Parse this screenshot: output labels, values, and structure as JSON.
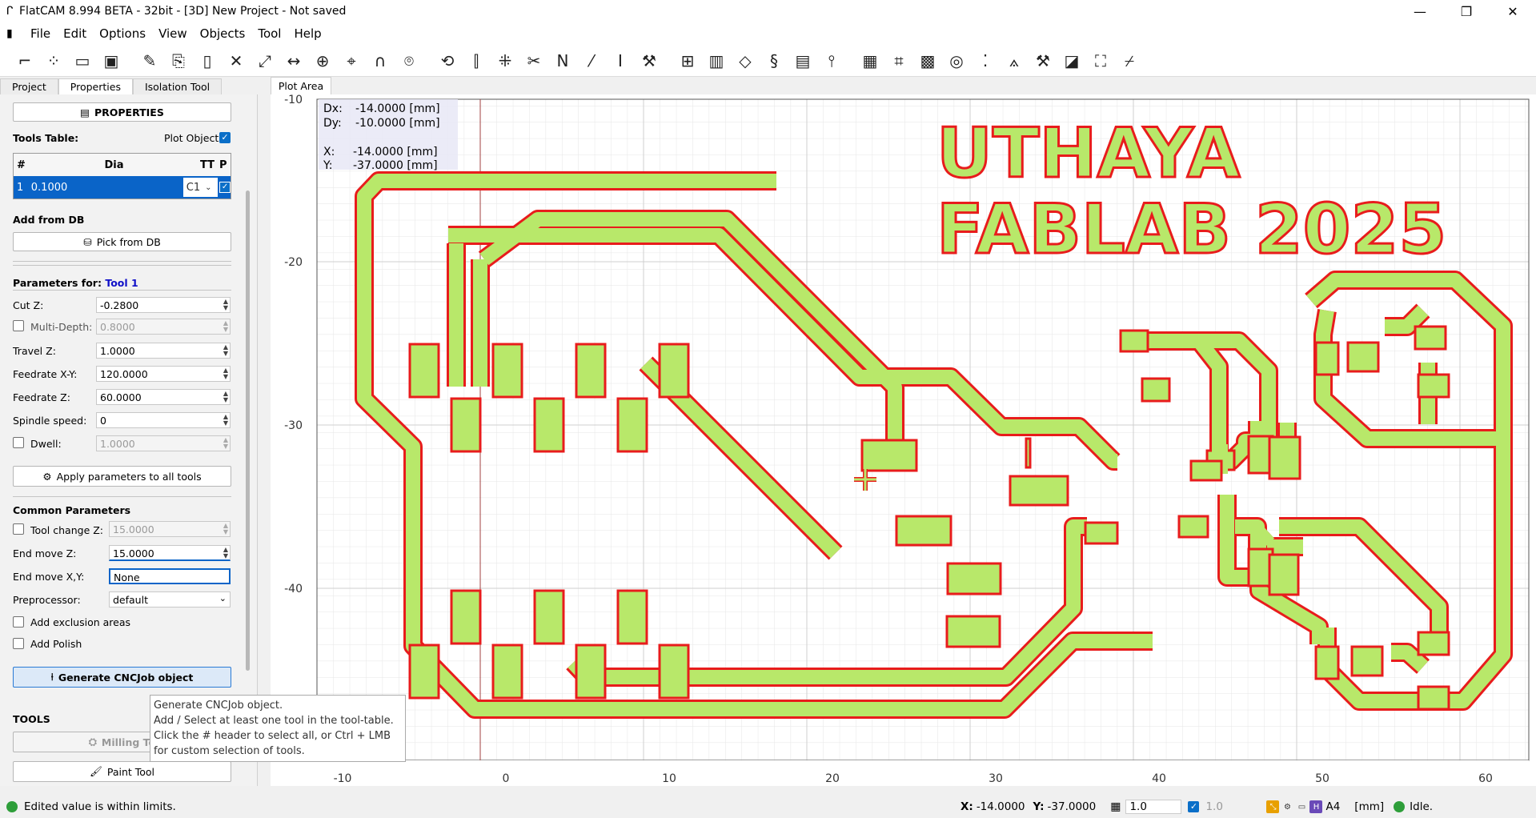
{
  "window": {
    "title": "FlatCAM 8.994 BETA - 32bit - [3D]    New Project - Not saved",
    "minimize": "—",
    "maximize": "❐",
    "close": "✕"
  },
  "menu": [
    "File",
    "Edit",
    "Options",
    "View",
    "Objects",
    "Tool",
    "Help"
  ],
  "tabs": {
    "project": "Project",
    "properties": "Properties",
    "isolation": "Isolation Tool"
  },
  "panel": {
    "properties_btn": "PROPERTIES",
    "tools_table_label": "Tools Table:",
    "plot_object_label": "Plot Object",
    "table": {
      "headers": [
        "#",
        "Dia",
        "TT",
        "P"
      ],
      "rows": [
        {
          "num": "1",
          "dia": "0.1000",
          "tt": "C1"
        }
      ]
    },
    "add_from_db": "Add from DB",
    "pick_from_db": "Pick from DB",
    "params_for": "Parameters for:",
    "params_tool": "Tool 1",
    "fields": [
      {
        "label": "Cut Z:",
        "value": "-0.2800"
      },
      {
        "label": "Multi-Depth:",
        "value": "0.8000"
      },
      {
        "label": "Travel Z:",
        "value": "1.0000"
      },
      {
        "label": "Feedrate X-Y:",
        "value": "120.0000"
      },
      {
        "label": "Feedrate Z:",
        "value": "60.0000"
      },
      {
        "label": "Spindle speed:",
        "value": "0"
      },
      {
        "label": "Dwell:",
        "value": "1.0000"
      }
    ],
    "apply_all": "Apply parameters to all tools",
    "common": "Common Parameters",
    "toolchange_label": "Tool change Z:",
    "toolchange_value": "15.0000",
    "endmovez_label": "End move Z:",
    "endmovez_value": "15.0000",
    "endmovexy_label": "End move X,Y:",
    "endmovexy_value": "None",
    "preprocessor_label": "Preprocessor:",
    "preprocessor_value": "default",
    "exclusion": "Add exclusion areas",
    "polish": "Add Polish",
    "generate": "Generate CNCJob object",
    "tools_header": "TOOLS",
    "milling": "Milling To",
    "paint": "Paint Tool"
  },
  "tooltip": [
    "Generate CNCJob object.",
    "Add / Select at least one tool in the tool-table.",
    "Click the # header to select all, or Ctrl + LMB",
    "for custom selection of tools."
  ],
  "plot": {
    "tab": "Plot Area",
    "readout": {
      "dx_label": "Dx:",
      "dx": "-14.0000 [mm]",
      "dy_label": "Dy:",
      "dy": "-10.0000 [mm]",
      "x_label": "X:",
      "x": "-14.0000 [mm]",
      "y_label": "Y:",
      "y": "-37.0000 [mm]"
    },
    "x_ticks": [
      "-10",
      "0",
      "10",
      "20",
      "30",
      "40",
      "50",
      "60"
    ],
    "y_ticks": [
      "-10",
      "-20",
      "-30",
      "-40"
    ],
    "text_line1": "UTHAYA",
    "text_line2": "FABLAB 2025",
    "trace_fill": "#b8e86a",
    "trace_outline": "#e81c1c"
  },
  "status": {
    "message": "Edited value is within limits.",
    "x_label": "X:",
    "x": "-14.0000",
    "y_label": "Y:",
    "y": "-37.0000",
    "grid1": "1.0",
    "grid2": "1.0",
    "a4": "A4",
    "units": "[mm]",
    "state": "Idle."
  }
}
